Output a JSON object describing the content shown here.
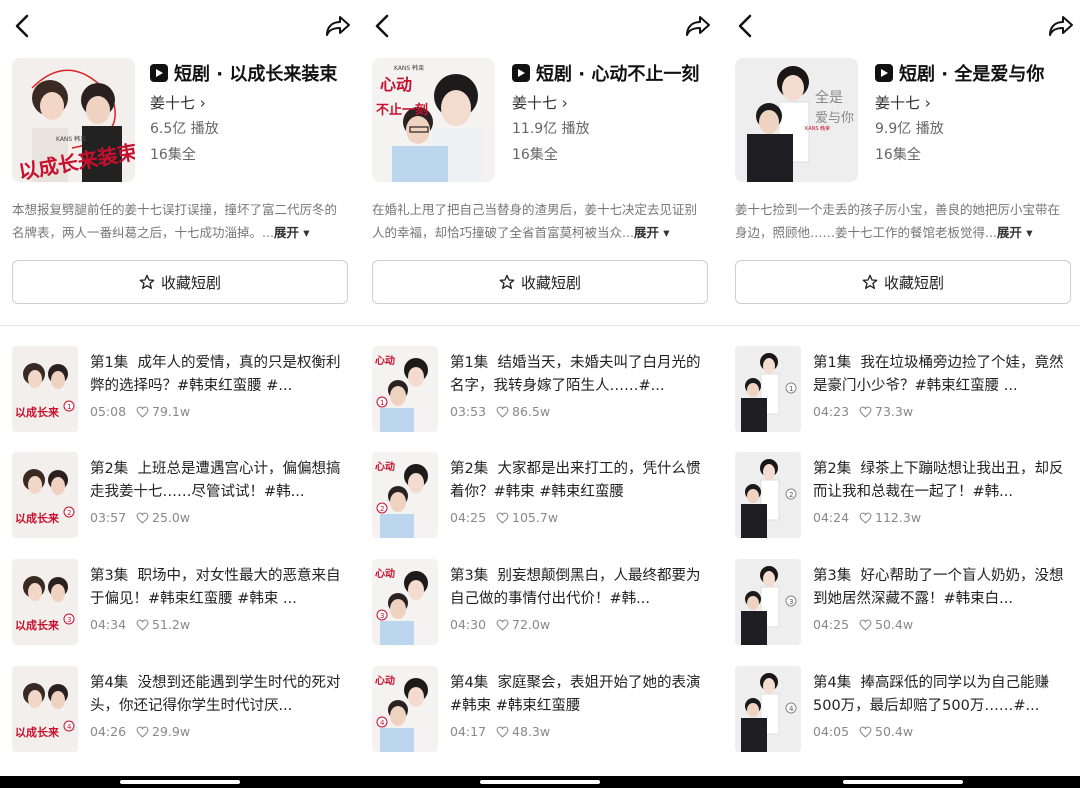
{
  "panels": [
    {
      "title": "短剧 · 以成长来装束",
      "author": "姜十七 ›",
      "plays": "6.5亿 播放",
      "episodes_total": "16集全",
      "description": "本想报复劈腿前任的姜十七误打误撞，撞坏了富二代厉冬的名牌表，两人一番纠葛之后，十七成功淄掉。...",
      "expand_label": "展开 ▾",
      "favorite_label": "收藏短剧",
      "cover_text": "以成长来装束",
      "episodes": [
        {
          "label": "第1集",
          "text": "成年人的爱情，真的只是权衡利弊的选择吗？#韩束红蛮腰 #...",
          "duration": "05:08",
          "likes": "79.1w",
          "num": "1"
        },
        {
          "label": "第2集",
          "text": "上班总是遭遇宫心计，偏偏想搞走我姜十七……尽管试试！#韩...",
          "duration": "03:57",
          "likes": "25.0w",
          "num": "2"
        },
        {
          "label": "第3集",
          "text": "职场中，对女性最大的恶意来自于偏见！#韩束红蛮腰 #韩束 ...",
          "duration": "04:34",
          "likes": "51.2w",
          "num": "3"
        },
        {
          "label": "第4集",
          "text": "没想到还能遇到学生时代的死对头，你还记得你学生时代讨厌...",
          "duration": "04:26",
          "likes": "29.9w",
          "num": "4"
        }
      ]
    },
    {
      "title": "短剧 · 心动不止一刻",
      "author": "姜十七 ›",
      "plays": "11.9亿 播放",
      "episodes_total": "16集全",
      "description": "在婚礼上甩了把自己当替身的渣男后，姜十七决定去见证别人的幸福，却恰巧撞破了全省首富莫柯被当众...",
      "expand_label": "展开 ▾",
      "favorite_label": "收藏短剧",
      "cover_text": "心动不止一刻",
      "episodes": [
        {
          "label": "第1集",
          "text": "结婚当天，未婚夫叫了白月光的名字，我转身嫁了陌生人……#...",
          "duration": "03:53",
          "likes": "86.5w",
          "num": "1"
        },
        {
          "label": "第2集",
          "text": "大家都是出来打工的，凭什么惯着你？#韩束 #韩束红蛮腰",
          "duration": "04:25",
          "likes": "105.7w",
          "num": "2"
        },
        {
          "label": "第3集",
          "text": "别妄想颠倒黑白，人最终都要为自己做的事情付出代价！#韩...",
          "duration": "04:30",
          "likes": "72.0w",
          "num": "3"
        },
        {
          "label": "第4集",
          "text": "家庭聚会，表姐开始了她的表演 #韩束 #韩束红蛮腰",
          "duration": "04:17",
          "likes": "48.3w",
          "num": "4"
        }
      ]
    },
    {
      "title": "短剧 · 全是爱与你",
      "author": "姜十七 ›",
      "plays": "9.9亿 播放",
      "episodes_total": "16集全",
      "description": "姜十七捡到一个走丢的孩子厉小宝，善良的她把厉小宝带在身边，照顾他……姜十七工作的餐馆老板觉得...",
      "expand_label": "展开 ▾",
      "favorite_label": "收藏短剧",
      "cover_text": "全是爱与你",
      "episodes": [
        {
          "label": "第1集",
          "text": "我在垃圾桶旁边捡了个娃，竟然是豪门小少爷？#韩束红蛮腰 ...",
          "duration": "04:23",
          "likes": "73.3w",
          "num": "1"
        },
        {
          "label": "第2集",
          "text": "绿茶上下蹦哒想让我出丑，却反而让我和总裁在一起了！#韩...",
          "duration": "04:24",
          "likes": "112.3w",
          "num": "2"
        },
        {
          "label": "第3集",
          "text": "好心帮助了一个盲人奶奶，没想到她居然深藏不露！#韩束白...",
          "duration": "04:25",
          "likes": "50.4w",
          "num": "3"
        },
        {
          "label": "第4集",
          "text": "捧高踩低的同学以为自己能赚500万，最后却赔了500万……#...",
          "duration": "04:05",
          "likes": "50.4w",
          "num": "4"
        }
      ]
    }
  ],
  "icons": {
    "back": "chevron-left-icon",
    "share": "share-arrow-icon",
    "play": "play-badge-icon",
    "star": "star-outline-icon",
    "heart": "heart-outline-icon"
  },
  "colors": {
    "accent_red": "#c8102e",
    "text": "#222222",
    "muted": "#888888"
  }
}
